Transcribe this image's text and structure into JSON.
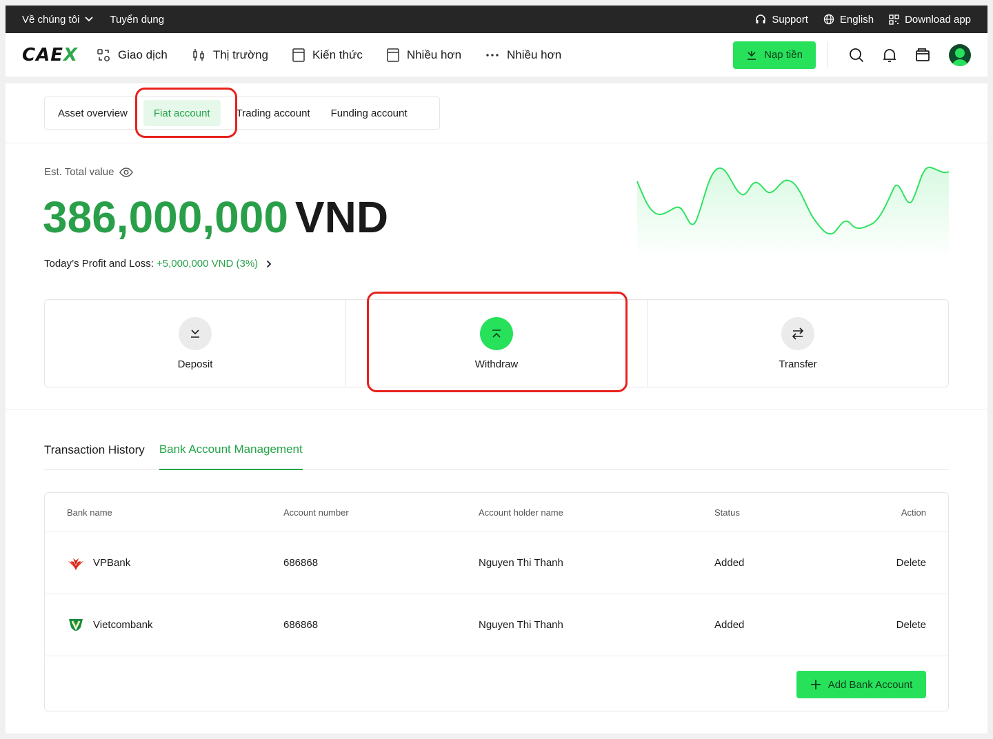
{
  "topbar": {
    "about": "Về chúng tôi",
    "careers": "Tuyển dụng",
    "support": "Support",
    "language": "English",
    "download": "Download app"
  },
  "nav": {
    "logo_main": "CAE",
    "logo_accent": "X",
    "items": [
      {
        "label": "Giao dịch",
        "icon": "exchange-icon"
      },
      {
        "label": "Thị trường",
        "icon": "candlestick-icon"
      },
      {
        "label": "Kiến thức",
        "icon": "book-icon"
      },
      {
        "label": "Nhiều hơn",
        "icon": "book-icon"
      },
      {
        "label": "Nhiều hơn",
        "icon": "more-dots-icon"
      }
    ],
    "deposit_button": "Nạp tiền"
  },
  "account_tabs": [
    "Asset overview",
    "Fiat account",
    "Trading account",
    "Funding account"
  ],
  "active_account_tab": "Fiat account",
  "summary": {
    "est_label": "Est. Total value",
    "total_value": "386,000,000",
    "currency": "VND",
    "pnl_label": "Today’s Profit and Loss:",
    "pnl_value": "+5,000,000 VND (3%)"
  },
  "actions": [
    {
      "label": "Deposit",
      "icon": "deposit-icon"
    },
    {
      "label": "Withdraw",
      "icon": "withdraw-icon"
    },
    {
      "label": "Transfer",
      "icon": "transfer-icon"
    }
  ],
  "section_tabs": [
    "Transaction History",
    "Bank Account Management"
  ],
  "active_section_tab": "Bank Account Management",
  "table": {
    "headers": [
      "Bank name",
      "Account number",
      "Account holder name",
      "Status",
      "Action"
    ],
    "rows": [
      {
        "bank": "VPBank",
        "number": "686868",
        "holder": "Nguyen Thi Thanh",
        "status": "Added",
        "action": "Delete"
      },
      {
        "bank": "Vietcombank",
        "number": "686868",
        "holder": "Nguyen Thi Thanh",
        "status": "Added",
        "action": "Delete"
      }
    ],
    "add_button": "Add Bank Account"
  },
  "colors": {
    "brand_green": "#27e15b",
    "text_green": "#2a9f4a",
    "highlight_red": "#e8201c",
    "topbar_bg": "#262626"
  }
}
